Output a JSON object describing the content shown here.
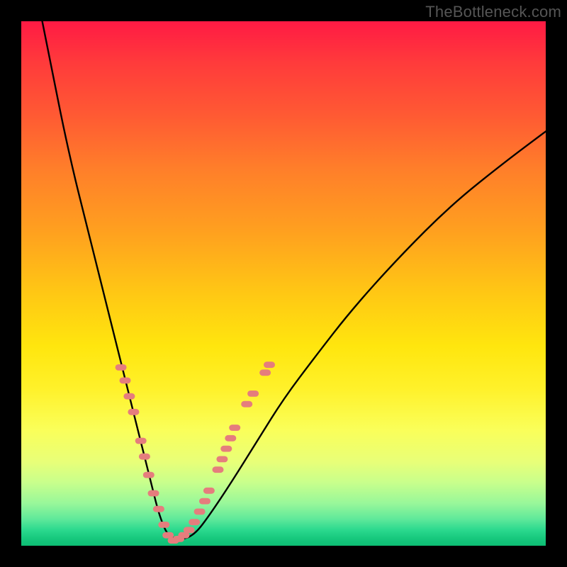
{
  "watermark": "TheBottleneck.com",
  "colors": {
    "frame": "#000000",
    "curve": "#000000",
    "marker_fill": "#e57d7d",
    "marker_stroke": "#d86a6a"
  },
  "chart_data": {
    "type": "line",
    "title": "",
    "xlabel": "",
    "ylabel": "",
    "xlim": [
      0,
      100
    ],
    "ylim": [
      0,
      100
    ],
    "grid": false,
    "legend": false,
    "series": [
      {
        "name": "bottleneck-curve",
        "x": [
          4,
          6,
          8,
          10,
          12,
          14,
          16,
          18,
          20,
          22,
          24,
          25,
          26,
          27,
          28,
          30,
          33,
          36,
          40,
          45,
          50,
          56,
          63,
          72,
          82,
          92,
          100
        ],
        "y": [
          100,
          90,
          80,
          71,
          63,
          55,
          47,
          39,
          31,
          23,
          15,
          11,
          7,
          4,
          2,
          1,
          2,
          6,
          12,
          20,
          28,
          36,
          45,
          55,
          65,
          73,
          79
        ]
      }
    ],
    "curve_min_x": 29,
    "markers": [
      {
        "x": 19.0,
        "y": 34.0
      },
      {
        "x": 19.8,
        "y": 31.5
      },
      {
        "x": 20.6,
        "y": 28.5
      },
      {
        "x": 21.4,
        "y": 25.5
      },
      {
        "x": 22.8,
        "y": 20.0
      },
      {
        "x": 23.5,
        "y": 17.0
      },
      {
        "x": 24.3,
        "y": 13.5
      },
      {
        "x": 25.2,
        "y": 10.0
      },
      {
        "x": 26.2,
        "y": 7.0
      },
      {
        "x": 27.2,
        "y": 4.0
      },
      {
        "x": 28.0,
        "y": 2.0
      },
      {
        "x": 29.0,
        "y": 1.0
      },
      {
        "x": 30.0,
        "y": 1.3
      },
      {
        "x": 31.0,
        "y": 2.0
      },
      {
        "x": 32.0,
        "y": 3.0
      },
      {
        "x": 33.0,
        "y": 4.5
      },
      {
        "x": 34.0,
        "y": 6.5
      },
      {
        "x": 35.0,
        "y": 8.5
      },
      {
        "x": 35.8,
        "y": 10.5
      },
      {
        "x": 37.5,
        "y": 14.5
      },
      {
        "x": 38.3,
        "y": 16.5
      },
      {
        "x": 39.1,
        "y": 18.5
      },
      {
        "x": 39.9,
        "y": 20.5
      },
      {
        "x": 40.7,
        "y": 22.5
      },
      {
        "x": 43.0,
        "y": 27.0
      },
      {
        "x": 44.2,
        "y": 29.0
      },
      {
        "x": 46.5,
        "y": 33.0
      },
      {
        "x": 47.3,
        "y": 34.5
      }
    ]
  }
}
